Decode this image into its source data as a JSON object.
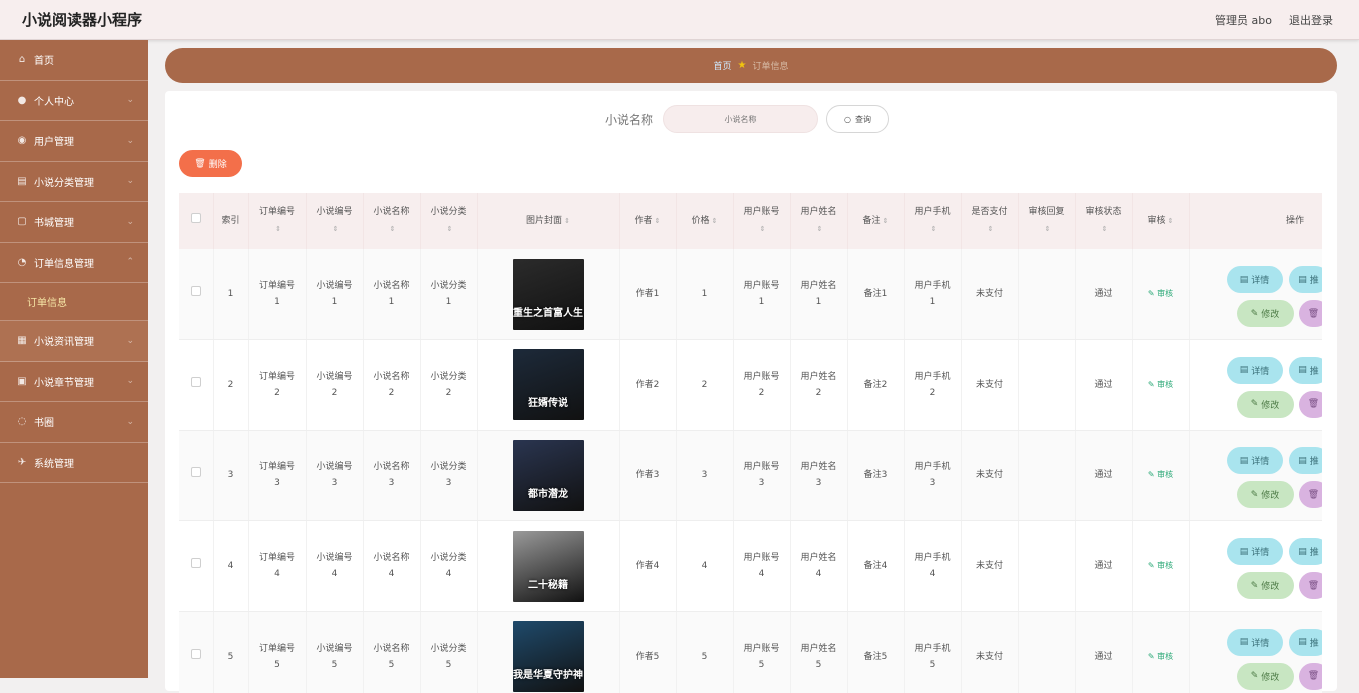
{
  "header": {
    "title": "小说阅读器小程序",
    "user_label": "管理员 abo",
    "logout_label": "退出登录"
  },
  "sidebar": {
    "items": [
      {
        "label": "首页",
        "icon": "home-icon",
        "glyph": "⌂"
      },
      {
        "label": "个人中心",
        "icon": "user-icon",
        "glyph": "●"
      },
      {
        "label": "用户管理",
        "icon": "users-icon",
        "glyph": "◉"
      },
      {
        "label": "小说分类管理",
        "icon": "category-icon",
        "glyph": "▤"
      },
      {
        "label": "书城管理",
        "icon": "book-icon",
        "glyph": "▢"
      },
      {
        "label": "订单信息管理",
        "icon": "order-icon",
        "glyph": "◔"
      },
      {
        "label": "小说资讯管理",
        "icon": "news-icon",
        "glyph": "▦"
      },
      {
        "label": "小说章节管理",
        "icon": "chapter-icon",
        "glyph": "▣"
      },
      {
        "label": "书圈",
        "icon": "circle-icon",
        "glyph": "◌"
      },
      {
        "label": "系统管理",
        "icon": "settings-icon",
        "glyph": "✈"
      }
    ],
    "sub_item": "订单信息"
  },
  "breadcrumb": {
    "home": "首页",
    "current": "订单信息"
  },
  "search": {
    "label": "小说名称",
    "placeholder": "小说名称",
    "button": "查询"
  },
  "actions": {
    "delete": "删除"
  },
  "table": {
    "columns": [
      "索引",
      "订单编号",
      "小说编号",
      "小说名称",
      "小说分类",
      "图片封面",
      "作者",
      "价格",
      "用户账号",
      "用户姓名",
      "备注",
      "用户手机",
      "是否支付",
      "审核回复",
      "审核状态",
      "审核",
      "操作"
    ],
    "rows": [
      {
        "index": "1",
        "order_no": "订单编号",
        "order_no_n": "1",
        "novel_no": "小说编号",
        "novel_no_n": "1",
        "novel_name": "小说名称",
        "novel_name_n": "1",
        "category": "小说分类",
        "category_n": "1",
        "cover_title": "重生之首富人生",
        "author": "作者1",
        "price": "1",
        "account": "用户账号",
        "account_n": "1",
        "user_name": "用户姓名",
        "user_name_n": "1",
        "remark": "备注1",
        "phone": "用户手机",
        "phone_n": "1",
        "paid": "未支付",
        "reply": "",
        "status": "通过",
        "audit": "审核",
        "cover_color": "#2b2b2b"
      },
      {
        "index": "2",
        "order_no": "订单编号",
        "order_no_n": "2",
        "novel_no": "小说编号",
        "novel_no_n": "2",
        "novel_name": "小说名称",
        "novel_name_n": "2",
        "category": "小说分类",
        "category_n": "2",
        "cover_title": "狂婿传说",
        "author": "作者2",
        "price": "2",
        "account": "用户账号",
        "account_n": "2",
        "user_name": "用户姓名",
        "user_name_n": "2",
        "remark": "备注2",
        "phone": "用户手机",
        "phone_n": "2",
        "paid": "未支付",
        "reply": "",
        "status": "通过",
        "audit": "审核",
        "cover_color": "#1d2a3a"
      },
      {
        "index": "3",
        "order_no": "订单编号",
        "order_no_n": "3",
        "novel_no": "小说编号",
        "novel_no_n": "3",
        "novel_name": "小说名称",
        "novel_name_n": "3",
        "category": "小说分类",
        "category_n": "3",
        "cover_title": "都市潜龙",
        "author": "作者3",
        "price": "3",
        "account": "用户账号",
        "account_n": "3",
        "user_name": "用户姓名",
        "user_name_n": "3",
        "remark": "备注3",
        "phone": "用户手机",
        "phone_n": "3",
        "paid": "未支付",
        "reply": "",
        "status": "通过",
        "audit": "审核",
        "cover_color": "#2a3550"
      },
      {
        "index": "4",
        "order_no": "订单编号",
        "order_no_n": "4",
        "novel_no": "小说编号",
        "novel_no_n": "4",
        "novel_name": "小说名称",
        "novel_name_n": "4",
        "category": "小说分类",
        "category_n": "4",
        "cover_title": "二十秘籍",
        "author": "作者4",
        "price": "4",
        "account": "用户账号",
        "account_n": "4",
        "user_name": "用户姓名",
        "user_name_n": "4",
        "remark": "备注4",
        "phone": "用户手机",
        "phone_n": "4",
        "paid": "未支付",
        "reply": "",
        "status": "通过",
        "audit": "审核",
        "cover_color": "#9a9a9a"
      },
      {
        "index": "5",
        "order_no": "订单编号",
        "order_no_n": "5",
        "novel_no": "小说编号",
        "novel_no_n": "5",
        "novel_name": "小说名称",
        "novel_name_n": "5",
        "category": "小说分类",
        "category_n": "5",
        "cover_title": "我是华夏守护神",
        "author": "作者5",
        "price": "5",
        "account": "用户账号",
        "account_n": "5",
        "user_name": "用户姓名",
        "user_name_n": "5",
        "remark": "备注5",
        "phone": "用户手机",
        "phone_n": "5",
        "paid": "未支付",
        "reply": "",
        "status": "通过",
        "audit": "审核",
        "cover_color": "#1f4a6b"
      }
    ],
    "op_detail": "详情",
    "op_detail2": "推",
    "op_edit": "修改"
  },
  "colors": {
    "sidebar": "#a8694a",
    "delete": "#f36f4a",
    "accent_green": "#2aa876"
  }
}
